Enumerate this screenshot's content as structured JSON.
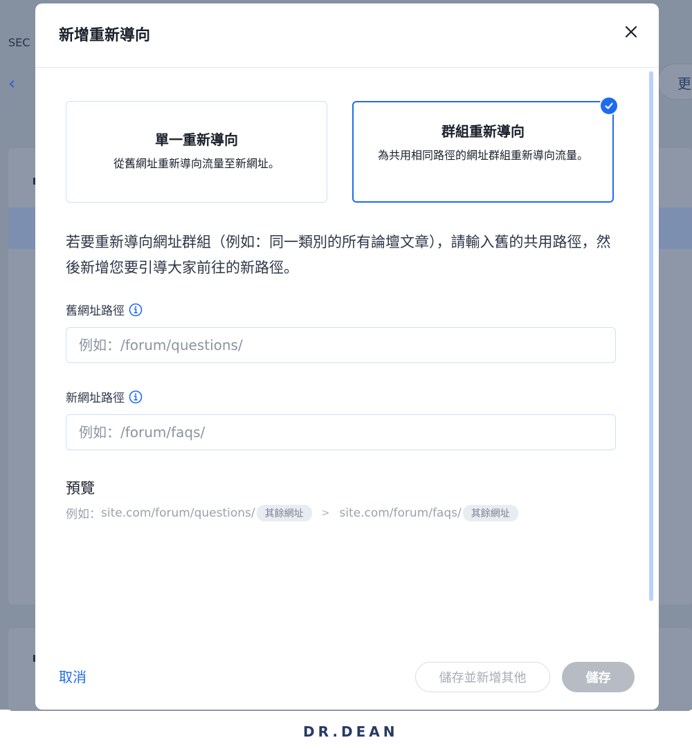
{
  "background": {
    "sec_label": "SEC",
    "more_label": "更"
  },
  "modal": {
    "title": "新增重新導向",
    "options": [
      {
        "title": "單一重新導向",
        "description": "從舊網址重新導向流量至新網址。",
        "selected": false
      },
      {
        "title": "群組重新導向",
        "description": "為共用相同路徑的網址群組重新導向流量。",
        "selected": true
      }
    ],
    "intro": "若要重新導向網址群組（例如：同一類別的所有論壇文章），請輸入舊的共用路徑，然後新增您要引導大家前往的新路徑。",
    "old_path": {
      "label": "舊網址路徑",
      "placeholder": "例如：/forum/questions/",
      "value": ""
    },
    "new_path": {
      "label": "新網址路徑",
      "placeholder": "例如：/forum/faqs/",
      "value": ""
    },
    "preview": {
      "title": "預覽",
      "prefix": "例如：",
      "old_url": "site.com/forum/questions/",
      "old_chip": "其餘網址",
      "arrow": ">",
      "new_url": "site.com/forum/faqs/",
      "new_chip": "其餘網址"
    },
    "footer": {
      "cancel": "取消",
      "save_and_add": "儲存並新增其他",
      "save": "儲存"
    }
  },
  "brand": "DR.DEAN",
  "colors": {
    "accent": "#1f6bf0",
    "overlay": "#8590a1",
    "disabled_button": "#b7bcc4"
  }
}
